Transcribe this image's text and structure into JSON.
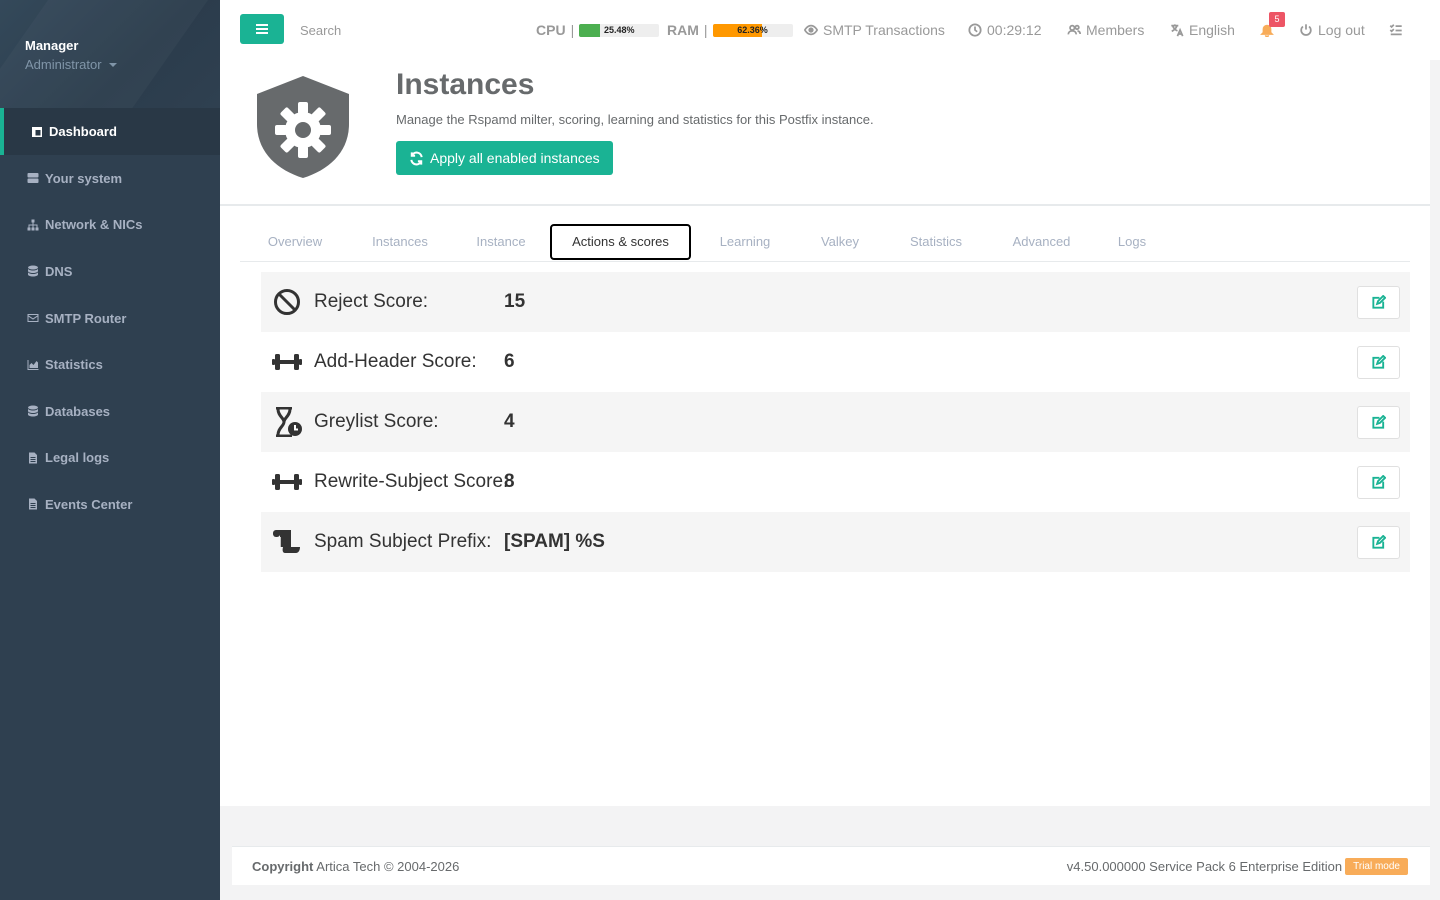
{
  "sidebar": {
    "user_name": "Manager",
    "user_role": "Administrator",
    "items": [
      {
        "label": "Dashboard",
        "icon": "dashboard-icon"
      },
      {
        "label": "Your system",
        "icon": "server-icon"
      },
      {
        "label": "Network & NICs",
        "icon": "network-icon"
      },
      {
        "label": "DNS",
        "icon": "database-icon"
      },
      {
        "label": "SMTP Router",
        "icon": "envelope-icon"
      },
      {
        "label": "Statistics",
        "icon": "chart-icon"
      },
      {
        "label": "Databases",
        "icon": "database-icon"
      },
      {
        "label": "Legal logs",
        "icon": "file-icon"
      },
      {
        "label": "Events Center",
        "icon": "file-icon"
      }
    ]
  },
  "topbar": {
    "search_placeholder": "Search",
    "cpu_label": "CPU",
    "cpu_value": "25.48%",
    "cpu_fraction": 0.2548,
    "ram_label": "RAM",
    "ram_value": "62.36%",
    "ram_fraction": 0.6236,
    "smtp_label": "SMTP Transactions",
    "clock": "00:29:12",
    "members_label": "Members",
    "language": "English",
    "notifications_count": "5",
    "logout_label": "Log out"
  },
  "header": {
    "title": "Instances",
    "description": "Manage the Rspamd milter, scoring, learning and statistics for this Postfix instance.",
    "apply_button": "Apply all enabled instances"
  },
  "tabs": [
    {
      "label": "Overview"
    },
    {
      "label": "Instances"
    },
    {
      "label": "Instance"
    },
    {
      "label": "Actions & scores",
      "active": true
    },
    {
      "label": "Learning"
    },
    {
      "label": "Valkey"
    },
    {
      "label": "Statistics"
    },
    {
      "label": "Advanced"
    },
    {
      "label": "Logs"
    }
  ],
  "rows": [
    {
      "label": "Reject Score:",
      "value": "15",
      "icon": "ban-icon"
    },
    {
      "label": "Add-Header Score:",
      "value": "6",
      "icon": "dumbbell-icon"
    },
    {
      "label": "Greylist Score:",
      "value": "4",
      "icon": "hourglass-clock-icon"
    },
    {
      "label": "Rewrite-Subject Score:",
      "value": "8",
      "icon": "dumbbell-icon"
    },
    {
      "label": "Spam Subject Prefix:",
      "value": "[SPAM] %S",
      "icon": "scroll-icon"
    }
  ],
  "footer": {
    "copyright_bold": "Copyright",
    "copyright_text": " Artica Tech © 2004-2026",
    "version": "v4.50.000000 Service Pack 6 Enterprise Edition",
    "trial": "Trial mode"
  },
  "colors": {
    "accent": "#1ab394",
    "sidebar": "#2f4050",
    "cpu_bar": "#4caf50",
    "ram_bar": "#ff9800",
    "badge": "#ed5565",
    "trial": "#f8ac59"
  }
}
